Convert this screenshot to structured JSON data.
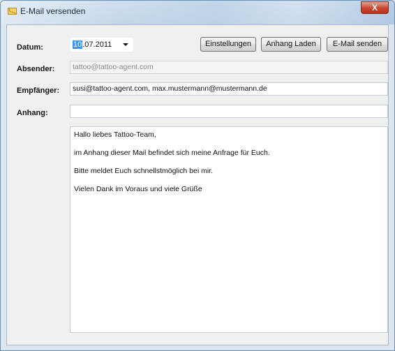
{
  "window": {
    "title": "E-Mail versenden",
    "close_glyph": "X",
    "icon": "envelope-icon"
  },
  "labels": {
    "datum": "Datum:",
    "absender": "Absender:",
    "empfaenger": "Empfänger:",
    "anhang": "Anhang:"
  },
  "date": {
    "selected_part": "10",
    "rest": ".07.2011"
  },
  "buttons": {
    "settings": "Einstellungen",
    "load_attachment": "Anhang Laden",
    "send": "E-Mail senden"
  },
  "fields": {
    "absender": "tattoo@tattoo-agent.com",
    "empfaenger": "susi@tattoo-agent.com, max.mustermann@mustermann.de",
    "anhang": ""
  },
  "message": {
    "lines": [
      "Hallo liebes Tattoo-Team,",
      "im Anhang dieser Mail befindet sich meine Anfrage für Euch.",
      "Bitte meldet Euch schnellstmöglich bei mir.",
      "Vielen Dank im Voraus und viele Grüße"
    ]
  }
}
